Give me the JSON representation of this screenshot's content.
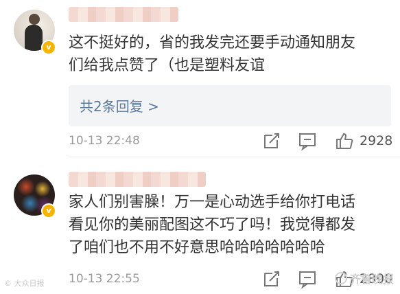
{
  "comments": [
    {
      "text_line1": "这不挺好的，省的我发完还要手动通知朋友",
      "text_line2": "们给我点赞了（也是塑料友谊",
      "replies_label": "共2条回复 >",
      "time": "10-13 22:48",
      "likes": "2928",
      "verified_mark": "v"
    },
    {
      "text_line1": "家人们别害臊！万一是心动选手给你打电话",
      "text_line2": "看见你的美丽配图这不巧了吗！我觉得都发",
      "text_line3": "了咱们也不用不好意思哈哈哈哈哈哈哈",
      "time": "10-13 22:55",
      "likes": "2890",
      "verified_mark": "v"
    }
  ],
  "icons": [
    "share-icon",
    "comment-icon",
    "thumbs-up-icon"
  ],
  "watermarks": {
    "left": "© 大众日报",
    "right": "齐鲁晚报"
  },
  "colors": {
    "link": "#5b7a9e",
    "verified_badge": "#f7b500",
    "reply_box_bg": "#f3f4f6"
  }
}
